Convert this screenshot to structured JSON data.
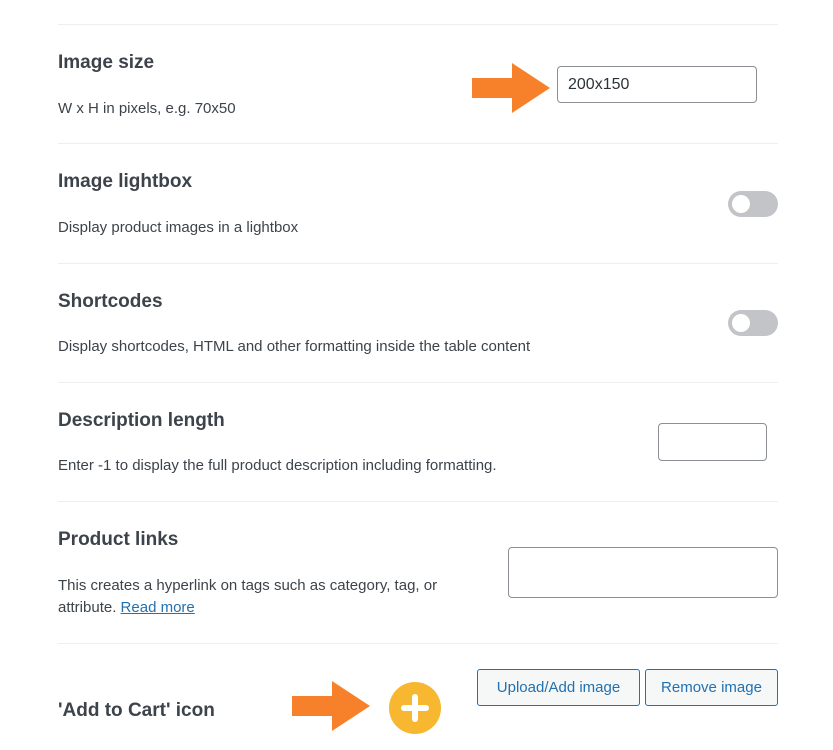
{
  "settings": {
    "image_size": {
      "title": "Image size",
      "description": "W x H in pixels, e.g. 70x50",
      "value": "200x150"
    },
    "image_lightbox": {
      "title": "Image lightbox",
      "description": "Display product images in a lightbox",
      "enabled": false
    },
    "shortcodes": {
      "title": "Shortcodes",
      "description": "Display shortcodes, HTML and other formatting inside the table content",
      "enabled": false
    },
    "description_length": {
      "title": "Description length",
      "description": "Enter -1 to display the full product description including formatting.",
      "value": ""
    },
    "product_links": {
      "title": "Product links",
      "description": "This creates a hyperlink on tags such as category, tag, or attribute.",
      "link_text": "Read more",
      "value": ""
    },
    "add_to_cart_icon": {
      "title": "'Add to Cart' icon",
      "upload_label": "Upload/Add image",
      "remove_label": "Remove image",
      "icon": "plus-circle-icon"
    }
  },
  "annotations": {
    "arrow_color": "#f7812a",
    "icon_color": "#f7b731"
  }
}
